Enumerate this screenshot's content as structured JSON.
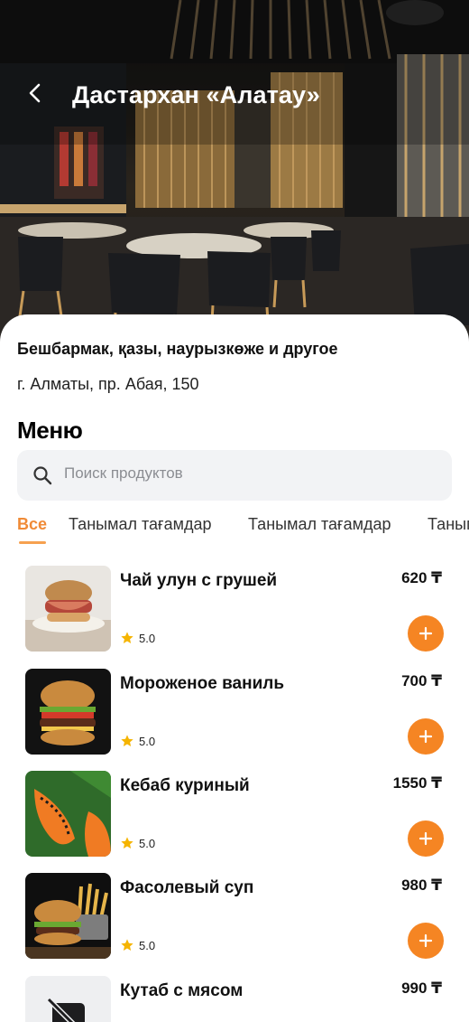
{
  "header": {
    "title": "Дастархан «Алатау»",
    "back_icon": "chevron-left-icon"
  },
  "restaurant": {
    "cuisine": "Бешбармак, қазы, наурызкөже и другое",
    "address": "г. Алматы, пр. Абая, 150"
  },
  "menu": {
    "heading": "Меню",
    "search_placeholder": "Поиск продуктов",
    "tabs": [
      {
        "label": "Все",
        "active": true
      },
      {
        "label": "Танымал тағамдар",
        "active": false
      },
      {
        "label": "Танымал тағамдар",
        "active": false
      },
      {
        "label": "Танымал тағамдар",
        "active": false
      }
    ]
  },
  "products": [
    {
      "name": "Чай улун с грушей",
      "price": "620 ₸",
      "rating": "5.0",
      "image": "pulled-burger"
    },
    {
      "name": "Мороженое ваниль",
      "price": "700 ₸",
      "rating": "5.0",
      "image": "burger"
    },
    {
      "name": "Кебаб куриный",
      "price": "1550 ₸",
      "rating": "5.0",
      "image": "papaya"
    },
    {
      "name": "Фасолевый суп",
      "price": "980 ₸",
      "rating": "5.0",
      "image": "burger-fries"
    },
    {
      "name": "Кутаб с мясом",
      "price": "990 ₸",
      "rating": "",
      "image": "no-image"
    }
  ],
  "colors": {
    "accent": "#f58523",
    "active_tab": "#f08a36",
    "star": "#f5b400",
    "search_bg": "#f2f3f5"
  }
}
